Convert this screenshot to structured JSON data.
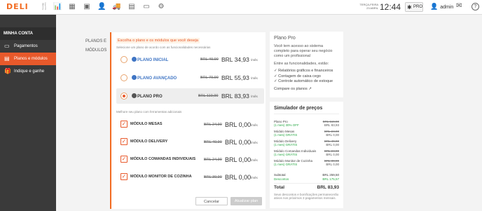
{
  "topbar": {
    "logo": "DELI",
    "date_line1": "TERÇA-FEIRA",
    "date_line2": "23 ABRIL",
    "time": "12:44",
    "pro_label": "PRO",
    "user": "admin",
    "icons": [
      "utensils-icon",
      "chart-icon",
      "calculator-icon",
      "wallet-icon",
      "user-icon",
      "truck-icon",
      "document-icon",
      "monitor-icon",
      "gear-icon"
    ]
  },
  "sidebar": {
    "title": "MINHA CONTA",
    "items": [
      {
        "label": "Pagamentos",
        "icon": "card-icon"
      },
      {
        "label": "Planos e módulos",
        "icon": "layers-icon",
        "active": true
      },
      {
        "label": "Indique e ganhe",
        "icon": "gift-icon"
      }
    ]
  },
  "breadcrumb": "PLANOS E MÓDULOS",
  "main": {
    "heading": "Escolha o plano e os módulos que você deseja",
    "subheading": "Selecione um plano de acordo com as funcionalidades necessárias",
    "plans": [
      {
        "name": "PLANO INICIAL",
        "old": "BRL 49,90",
        "price": "BRL 34,93",
        "per": "/mês",
        "selected": false
      },
      {
        "name": "PLANO AVANÇADO",
        "old": "BRL 79,90",
        "price": "BRL 55,93",
        "per": "/mês",
        "selected": false
      },
      {
        "name": "PLANO PRO",
        "old": "BRL 119,90",
        "price": "BRL 83,93",
        "per": "/mês",
        "selected": true
      }
    ],
    "upgrade_text": "Melhore seu plano com ferramentas adicionais",
    "modules": [
      {
        "name": "MÓDULO MESAS",
        "old": "BRL 24,90",
        "price": "BRL 0,00",
        "per": "/mês"
      },
      {
        "name": "MÓDULO DELIVERY",
        "old": "BRL 49,90",
        "price": "BRL 0,00",
        "per": "/mês"
      },
      {
        "name": "MÓDULO COMANDAS INDIVIDUAIS",
        "old": "BRL 24,90",
        "price": "BRL 0,00",
        "per": "/mês"
      },
      {
        "name": "MÓDULO MONITOR DE COZINHA",
        "old": "BRL 39,90",
        "price": "BRL 0,00",
        "per": "/mês"
      }
    ],
    "cancel_label": "Cancelar",
    "update_label": "Atualizar plan"
  },
  "plan_info": {
    "title": "Plano Pro",
    "description": "Você tem acesso ao sistema completo para operar seu negócio como um profissional",
    "features_intro": "Entre as funcionalidades, estão:",
    "features": [
      "Relatórios gráficos e financeiros",
      "Contagem de caixa cego",
      "Controle automático de estoque"
    ],
    "compare_link": "Compare os planos"
  },
  "simulator": {
    "title": "Simulador de preços",
    "rows": [
      {
        "name": "Plano Pro",
        "detail": "(1 mes) 30% OFF",
        "old": "BRL 119,90",
        "price": "BRL 83,93"
      },
      {
        "name": "Módulo Mesas",
        "detail": "(1 mes) GRÁTIS",
        "old": "BRL 24,90",
        "price": "BRL 0,00"
      },
      {
        "name": "Módulo Delivery",
        "detail": "(1 mes) GRÁTIS",
        "old": "BRL 49,90",
        "price": "BRL 0,00"
      },
      {
        "name": "Módulo Comandas Individuais",
        "detail": "(1 mes) GRÁTIS",
        "old": "BRL 24,90",
        "price": "BRL 0,00"
      },
      {
        "name": "Módulo Monitor de Cozinha",
        "detail": "(1 mes) GRÁTIS",
        "old": "BRL 39,90",
        "price": "BRL 0,00"
      }
    ],
    "subtotal_label": "Subtotal",
    "subtotal_value": "BRL 259,50",
    "discount_label": "Descontos",
    "discount_value": "BRL 175,57",
    "total_label": "Total",
    "total_value": "BRL 83,93",
    "note": "Seus descontos e bonificações permanecerão ativos nos próximos 3 pagamentos mensais."
  }
}
